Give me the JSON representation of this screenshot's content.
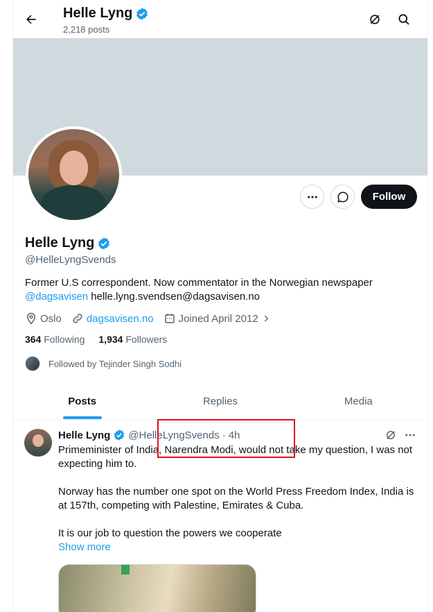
{
  "header": {
    "name": "Helle Lyng",
    "posts": "2,218 posts"
  },
  "profile": {
    "name": "Helle Lyng",
    "handle": "@HelleLyngSvends",
    "bio_text": "Former U.S correspondent. Now commentator in the Norwegian newspaper",
    "bio_link": "@dagsavisen",
    "bio_email": " helle.lyng.svendsen@dagsavisen.no",
    "location": "Oslo",
    "website": "dagsavisen.no",
    "joined": "Joined April 2012",
    "following_count": "364",
    "following_label": "Following",
    "followers_count": "1,934",
    "followers_label": "Followers",
    "followed_by": "Followed by Tejinder Singh Sodhi",
    "follow_label": "Follow"
  },
  "tabs": [
    {
      "label": "Posts",
      "active": true
    },
    {
      "label": "Replies",
      "active": false
    },
    {
      "label": "Media",
      "active": false
    }
  ],
  "tweet": {
    "name": "Helle Lyng",
    "handle": "@HelleLyngSvends",
    "sep": "·",
    "time": "4h",
    "line1": "Primeminister of India, Narendra Modi, would not take my question, I was not expecting him to.",
    "line2": "Norway has the number one spot on the World Press Freedom Index, India is at 157th, competing with Palestine, Emirates & Cuba.",
    "line3": "It is our job to question the powers we cooperate",
    "show_more": "Show more"
  },
  "colors": {
    "accent": "#1d9bf0",
    "highlight": "#e0101c",
    "banner": "#cfd9de"
  }
}
